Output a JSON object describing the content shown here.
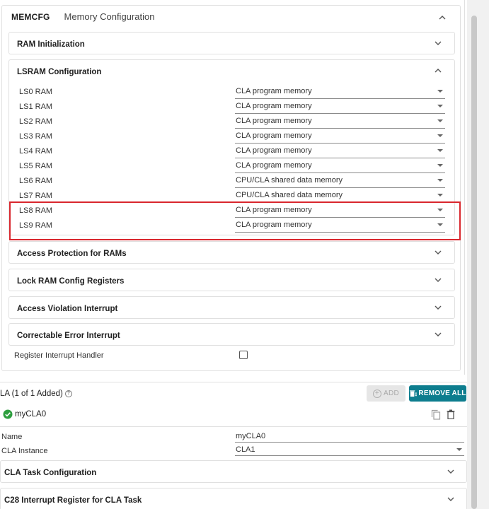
{
  "memcfg": {
    "code": "MEMCFG",
    "title": "Memory Configuration"
  },
  "sections": {
    "ram_init": "RAM Initialization",
    "lsram_config": "LSRAM Configuration",
    "access_protection": "Access Protection for RAMs",
    "lock_ram": "Lock RAM Config Registers",
    "access_violation": "Access Violation Interrupt",
    "correctable_error": "Correctable Error Interrupt"
  },
  "lsram": [
    {
      "label": "LS0 RAM",
      "value": "CLA program memory"
    },
    {
      "label": "LS1 RAM",
      "value": "CLA program memory"
    },
    {
      "label": "LS2 RAM",
      "value": "CLA program memory"
    },
    {
      "label": "LS3 RAM",
      "value": "CLA program memory"
    },
    {
      "label": "LS4 RAM",
      "value": "CLA program memory"
    },
    {
      "label": "LS5 RAM",
      "value": "CLA program memory"
    },
    {
      "label": "LS6 RAM",
      "value": "CPU/CLA shared data memory"
    },
    {
      "label": "LS7 RAM",
      "value": "CPU/CLA shared data memory"
    },
    {
      "label": "LS8 RAM",
      "value": "CLA program memory"
    },
    {
      "label": "LS9 RAM",
      "value": "CLA program memory"
    }
  ],
  "register_interrupt_handler": {
    "label": "Register Interrupt Handler",
    "checked": false
  },
  "cla": {
    "header": "LA (1 of 1 Added)",
    "help": "?",
    "add_label": "ADD",
    "remove_all_label": "REMOVE ALL",
    "instance_name": "myCLA0",
    "fields": {
      "name_label": "Name",
      "name_value": "myCLA0",
      "instance_label": "CLA Instance",
      "instance_value": "CLA1"
    },
    "task_config": "CLA Task Configuration",
    "c28_interrupt": "C28 Interrupt Register for CLA Task"
  },
  "colors": {
    "accent": "#0d7d8e",
    "highlight": "#d9272e",
    "success": "#2e9e3f"
  }
}
